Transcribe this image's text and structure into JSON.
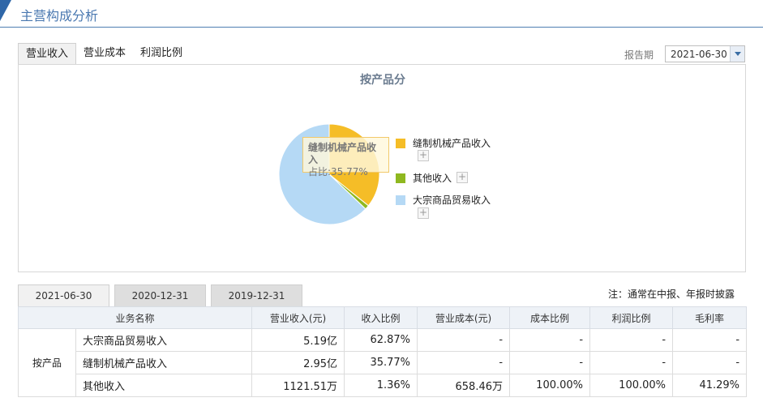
{
  "header": {
    "title": "主营构成分析"
  },
  "tabs": [
    "营业收入",
    "营业成本",
    "利润比例"
  ],
  "report": {
    "label": "报告期",
    "value": "2021-06-30"
  },
  "chart_data": {
    "type": "pie",
    "title": "按产品分",
    "slices": [
      {
        "name": "缝制机械产品收入",
        "value": 35.77,
        "color": "#f5bd27"
      },
      {
        "name": "其他收入",
        "value": 1.36,
        "color": "#8fb820"
      },
      {
        "name": "大宗商品贸易收入",
        "value": 62.87,
        "color": "#b5d9f5"
      }
    ],
    "tooltip": {
      "name": "缝制机械产品收入",
      "text": "占比:35.77%"
    },
    "plus": "+"
  },
  "date_tabs": [
    "2021-06-30",
    "2020-12-31",
    "2019-12-31"
  ],
  "note": "注：通常在中报、年报时披露",
  "table": {
    "headers": [
      "业务名称",
      "营业收入(元)",
      "收入比例",
      "营业成本(元)",
      "成本比例",
      "利润比例",
      "毛利率"
    ],
    "group": "按产品",
    "rows": [
      [
        "大宗商品贸易收入",
        "5.19亿",
        "62.87%",
        "-",
        "-",
        "-",
        "-"
      ],
      [
        "缝制机械产品收入",
        "2.95亿",
        "35.77%",
        "-",
        "-",
        "-",
        "-"
      ],
      [
        "其他收入",
        "1121.51万",
        "1.36%",
        "658.46万",
        "100.00%",
        "100.00%",
        "41.29%"
      ]
    ]
  }
}
